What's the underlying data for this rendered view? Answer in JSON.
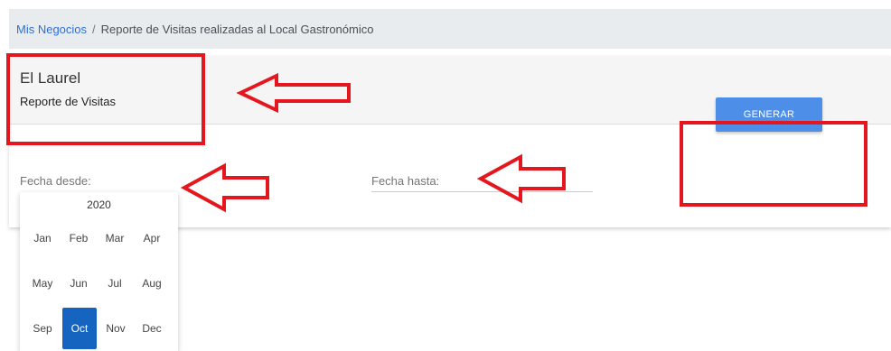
{
  "breadcrumb": {
    "link": "Mis Negocios",
    "separator": "/",
    "current": "Reporte de Visitas realizadas al Local Gastronómico"
  },
  "card": {
    "business_name": "El Laurel",
    "subtitle": "Reporte de Visitas"
  },
  "filters": {
    "from_label": "Fecha desde:",
    "to_label": "Fecha hasta:",
    "generate_label": "GENERAR"
  },
  "picker": {
    "year": "2020",
    "months": [
      "Jan",
      "Feb",
      "Mar",
      "Apr",
      "May",
      "Jun",
      "Jul",
      "Aug",
      "Sep",
      "Oct",
      "Nov",
      "Dec"
    ],
    "selected_month": "Oct"
  },
  "colors": {
    "annotation": "#e4171f",
    "button": "#4d8fe8",
    "link": "#2f6fd1",
    "selected_month": "#1565c0"
  }
}
